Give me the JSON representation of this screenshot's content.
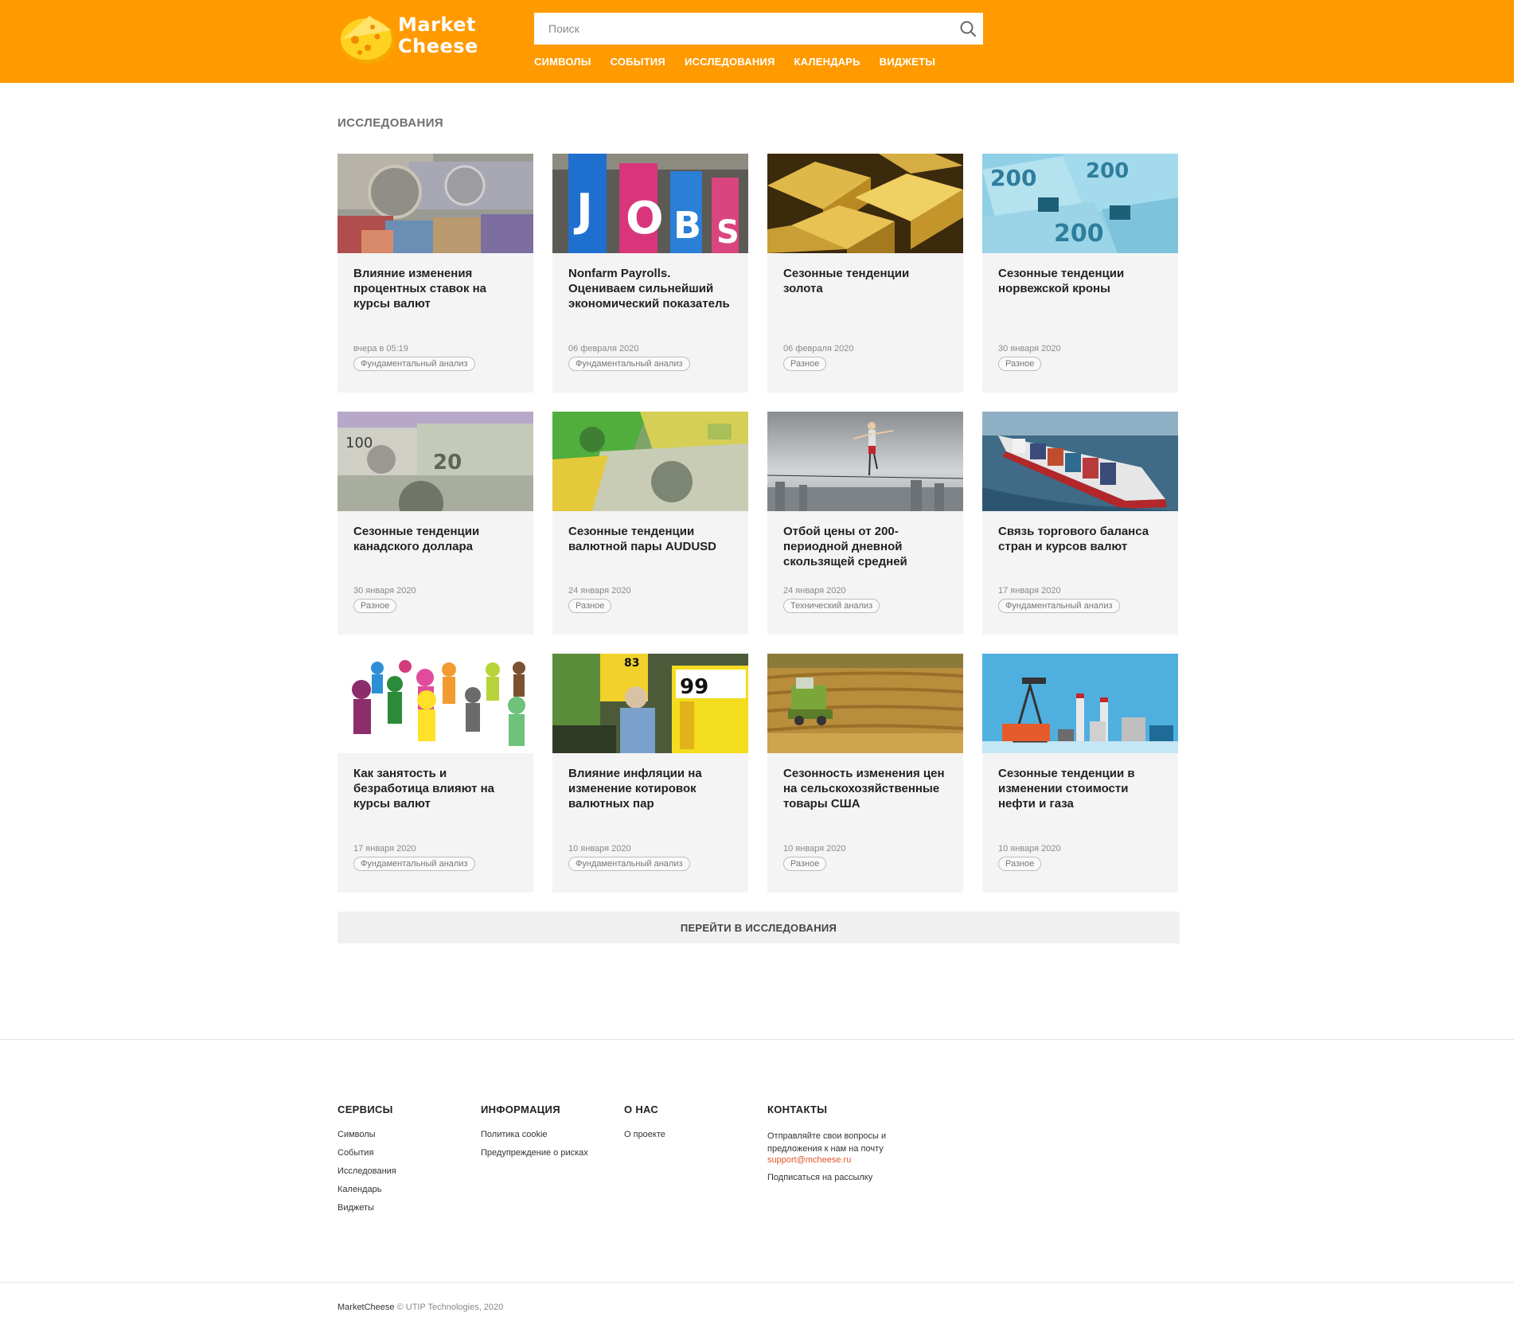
{
  "header": {
    "logo_line1": "Market",
    "logo_line2": "Cheese",
    "search_placeholder": "Поиск",
    "nav": [
      "СИМВОЛЫ",
      "СОБЫТИЯ",
      "ИССЛЕДОВАНИЯ",
      "КАЛЕНДАРЬ",
      "ВИДЖЕТЫ"
    ],
    "brand_color": "#ff9a00"
  },
  "main": {
    "section_title": "ИССЛЕДОВАНИЯ",
    "cards": [
      {
        "title": "Влияние изменения процентных ставок на курсы валют",
        "date": "вчера в 05:19",
        "tag": "Фундаментальный анализ",
        "image": "currency-banknotes"
      },
      {
        "title": "Nonfarm Payrolls. Оцениваем сильнейший экономический показатель",
        "date": "06 февраля 2020",
        "tag": "Фундаментальный анализ",
        "image": "jobs-banners"
      },
      {
        "title": "Сезонные тенденции золота",
        "date": "06 февраля 2020",
        "tag": "Разное",
        "image": "gold-bars"
      },
      {
        "title": "Сезонные тенденции норвежской кроны",
        "date": "30 января 2020",
        "tag": "Разное",
        "image": "norwegian-krone-notes"
      },
      {
        "title": "Сезонные тенденции канадского доллара",
        "date": "30 января 2020",
        "tag": "Разное",
        "image": "canadian-dollar-notes"
      },
      {
        "title": "Сезонные тенденции валютной пары AUDUSD",
        "date": "24 января 2020",
        "tag": "Разное",
        "image": "aud-usd-notes"
      },
      {
        "title": "Отбой цены от 200-периодной дневной скользящей средней",
        "date": "24 января 2020",
        "tag": "Технический анализ",
        "image": "tightrope-walker"
      },
      {
        "title": "Связь торгового баланса стран и курсов валют",
        "date": "17 января 2020",
        "tag": "Фундаментальный анализ",
        "image": "container-ship"
      },
      {
        "title": "Как занятость и безработица влияют на курсы валют",
        "date": "17 января 2020",
        "tag": "Фундаментальный анализ",
        "image": "workers-illustration"
      },
      {
        "title": "Влияние инфляции на изменение котировок валютных пар",
        "date": "10 января 2020",
        "tag": "Фундаментальный анализ",
        "image": "supermarket-prices"
      },
      {
        "title": "Сезонность изменения цен на сельскохозяйственные товары США",
        "date": "10 января 2020",
        "tag": "Разное",
        "image": "harvester-field"
      },
      {
        "title": "Сезонные тенденции в изменении стоимости нефти и газа",
        "date": "10 января 2020",
        "tag": "Разное",
        "image": "oil-gas-plant"
      }
    ],
    "more_button": "ПЕРЕЙТИ В ИССЛЕДОВАНИЯ"
  },
  "footer": {
    "services": {
      "title": "СЕРВИСЫ",
      "links": [
        "Символы",
        "События",
        "Исследования",
        "Календарь",
        "Виджеты"
      ]
    },
    "info": {
      "title": "ИНФОРМАЦИЯ",
      "links": [
        "Политика cookie",
        "Предупреждение о рисках"
      ]
    },
    "about": {
      "title": "О НАС",
      "links": [
        "О проекте"
      ]
    },
    "contacts": {
      "title": "КОНТАКТЫ",
      "text": "Отправляйте свои вопросы и предложения к нам на почту",
      "email": "support@mcheese.ru",
      "subscribe": "Подписаться на рассылку"
    },
    "copyright_brand": "MarketCheese",
    "copyright_rest": "© UTIP Technologies, 2020"
  }
}
